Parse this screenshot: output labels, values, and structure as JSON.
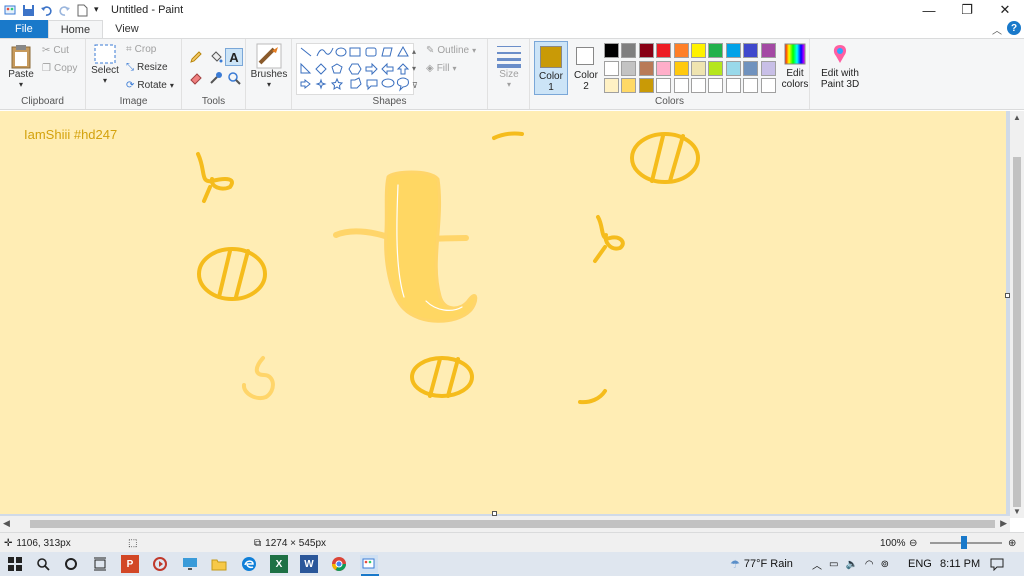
{
  "window": {
    "title": "Untitled - Paint",
    "minimize": "—",
    "restore": "❐",
    "close": "✕",
    "collapse": "︿",
    "help": "?"
  },
  "tabs": [
    "File",
    "Home",
    "View"
  ],
  "clipboard": {
    "paste": "Paste",
    "cut": "Cut",
    "copy": "Copy",
    "label": "Clipboard"
  },
  "image": {
    "select": "Select",
    "crop": "Crop",
    "resize": "Resize",
    "rotate": "Rotate",
    "label": "Image"
  },
  "tools": {
    "label": "Tools"
  },
  "brushes": {
    "label": "Brushes"
  },
  "shapes": {
    "outline": "Outline",
    "fill": "Fill",
    "label": "Shapes"
  },
  "size": {
    "label": "Size"
  },
  "colors": {
    "color1": "Color 1",
    "color1_value": "#c99a06",
    "color2": "Color 2",
    "color2_value": "#ffffff",
    "edit": "Edit colors",
    "paint3d": "Edit with Paint 3D",
    "label": "Colors",
    "palette": [
      "#000000",
      "#7f7f7f",
      "#880015",
      "#ed1c24",
      "#ff7f27",
      "#fff200",
      "#22b14c",
      "#00a2e8",
      "#3f48cc",
      "#a349a4",
      "#ffffff",
      "#c3c3c3",
      "#b97a57",
      "#ffaec9",
      "#ffc90e",
      "#efe4b0",
      "#b5e61d",
      "#99d9ea",
      "#7092be",
      "#c8bfe7",
      "#fff1c4",
      "#ffd966",
      "#c99a06",
      "#ffffff",
      "#ffffff",
      "#ffffff",
      "#ffffff",
      "#ffffff",
      "#ffffff",
      "#ffffff"
    ]
  },
  "canvas": {
    "text": "IamShiii #hd247",
    "background": "#ffedb4",
    "stroke_color": "#f5bc1c"
  },
  "status": {
    "cursor_pos": "1106, 313px",
    "canvas_size": "1274 × 545px",
    "zoom": "100%"
  },
  "taskbar": {
    "weather": "77°F  Rain",
    "lang": "ENG",
    "time": "8:11 PM"
  }
}
